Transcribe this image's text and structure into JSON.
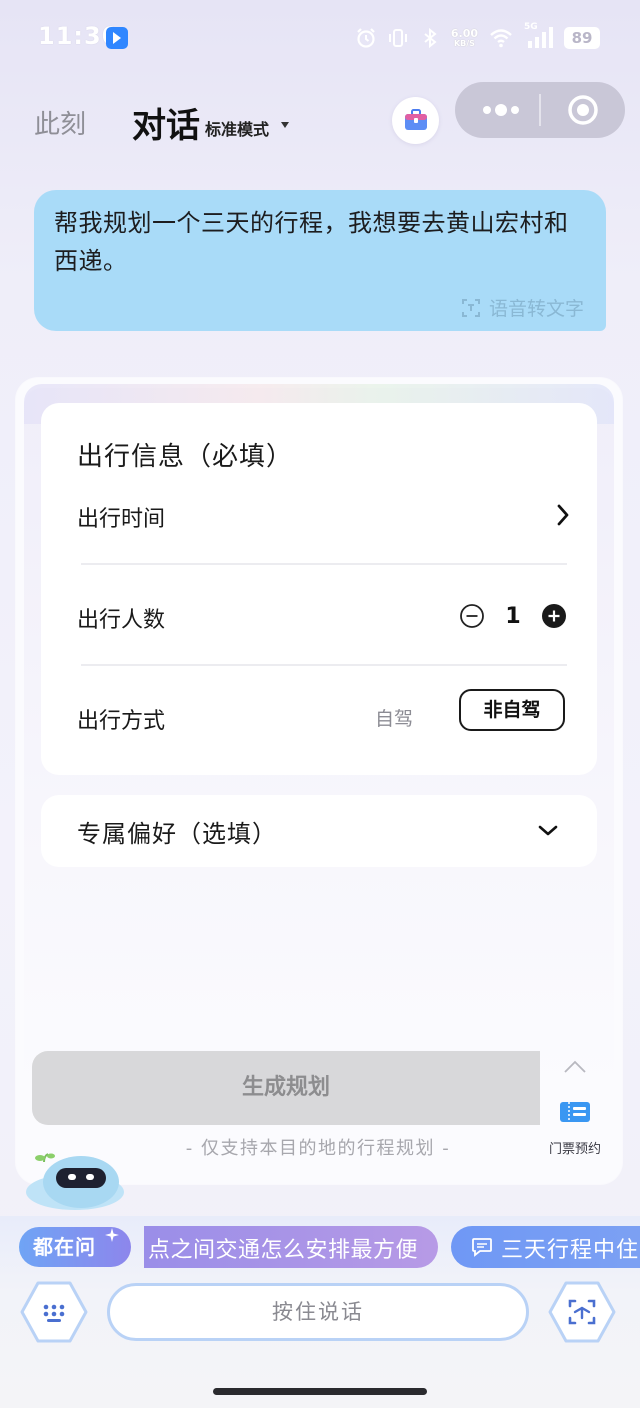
{
  "status_bar": {
    "time": "11:30",
    "speed_value": "6.00",
    "speed_unit": "KB/S",
    "network": "5G",
    "battery": "89"
  },
  "header": {
    "now_label": "此刻",
    "chat_label": "对话",
    "mode_label": "标准模式"
  },
  "user_message": {
    "text": "帮我规划一个三天的行程，我想要去黄山宏村和西递。",
    "voice_to_text": "语音转文字"
  },
  "trip_form": {
    "info_title": "出行信息（必填）",
    "time_label": "出行时间",
    "people_label": "出行人数",
    "people_count": "1",
    "mode_label": "出行方式",
    "mode_option_self": "自驾",
    "mode_option_nonself": "非自驾",
    "preference_title": "专属偏好（选填）"
  },
  "actions": {
    "generate_label": "生成规划",
    "hint": "- 仅支持本目的地的行程规划 -",
    "ticket_label": "门票预约"
  },
  "suggestions": {
    "everyone_label": "都在问",
    "question_text": "点之间交通怎么安排最方便",
    "trip_text": "三天行程中住"
  },
  "input_bar": {
    "hold_to_talk": "按住说话"
  },
  "colors": {
    "bubble": "#a9dbf8",
    "generate_disabled": "#d8d8da",
    "chip_blue": "#6fa4f5",
    "chip_purple": "#9a8ee8"
  }
}
